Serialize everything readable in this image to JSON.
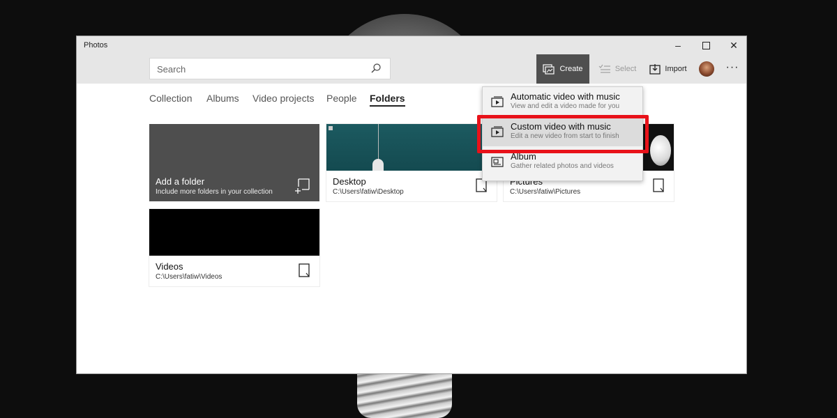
{
  "app": {
    "title": "Photos"
  },
  "window_controls": {
    "minimize": "–",
    "close": "✕"
  },
  "search": {
    "placeholder": "Search"
  },
  "toolbar": {
    "create_label": "Create",
    "select_label": "Select",
    "import_label": "Import",
    "more_label": "···"
  },
  "tabs": [
    {
      "label": "Collection",
      "active": false
    },
    {
      "label": "Albums",
      "active": false
    },
    {
      "label": "Video projects",
      "active": false
    },
    {
      "label": "People",
      "active": false
    },
    {
      "label": "Folders",
      "active": true
    }
  ],
  "folders": [
    {
      "name": "Add a folder",
      "path": "Include more folders in your collection",
      "icon": "add-folder-icon"
    },
    {
      "name": "Desktop",
      "path": "C:\\Users\\fatiw\\Desktop",
      "icon": "folder-icon"
    },
    {
      "name": "Pictures",
      "path": "C:\\Users\\fatiw\\Pictures",
      "icon": "folder-icon"
    },
    {
      "name": "Videos",
      "path": "C:\\Users\\fatiw\\Videos",
      "icon": "folder-icon"
    }
  ],
  "create_menu": {
    "items": [
      {
        "title": "Automatic video with music",
        "subtitle": "View and edit a video made for you",
        "icon": "video-icon"
      },
      {
        "title": "Custom video with music",
        "subtitle": "Edit a new video from start to finish",
        "icon": "video-icon",
        "hovered": true
      },
      {
        "title": "Album",
        "subtitle": "Gather related photos and videos",
        "icon": "album-icon"
      }
    ]
  },
  "colors": {
    "accent_highlight": "#e8121a",
    "create_button_bg": "#4f4f4f"
  }
}
